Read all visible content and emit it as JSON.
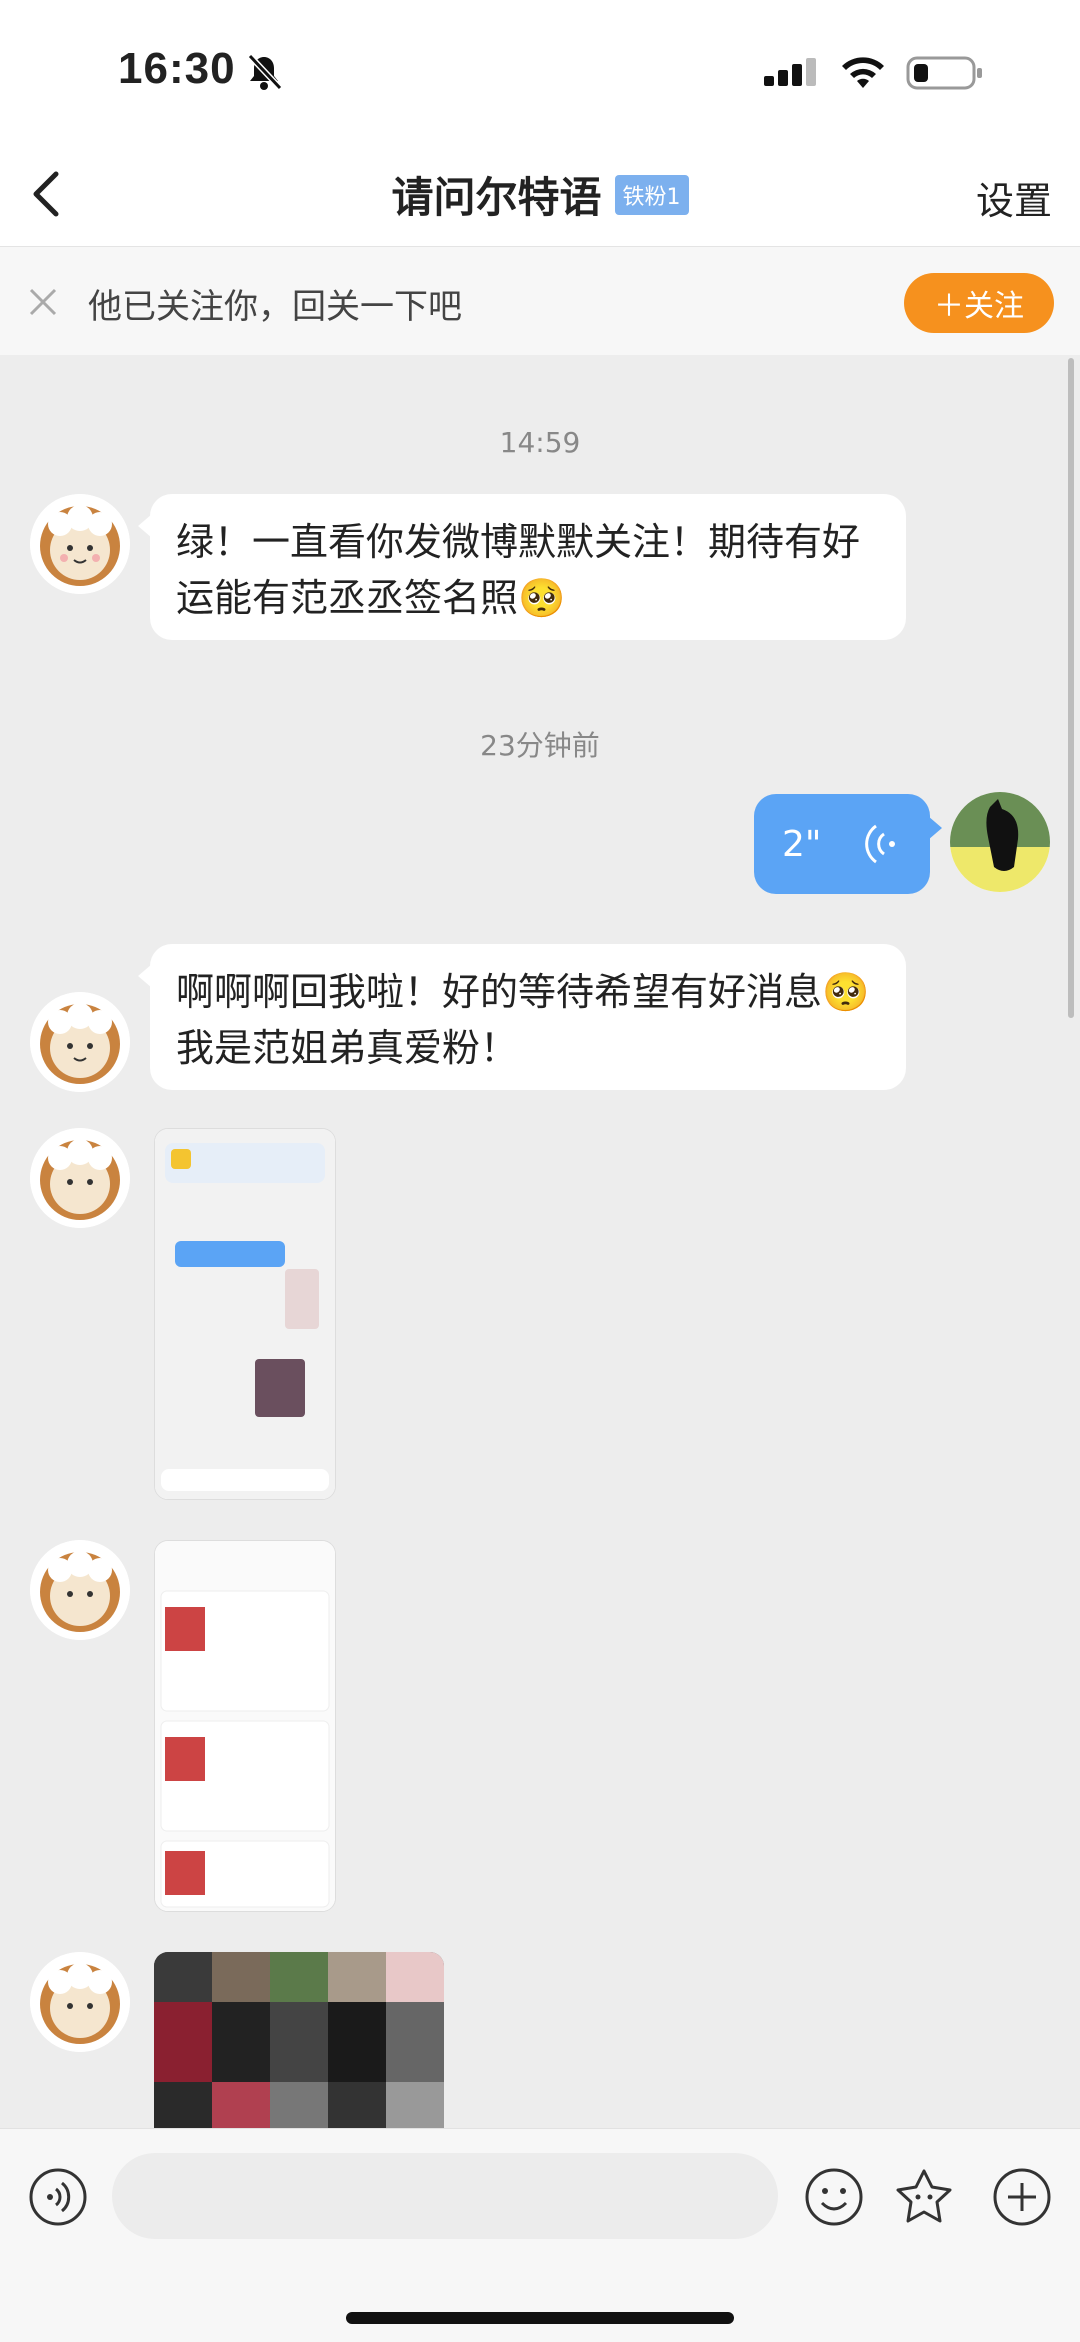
{
  "status": {
    "time": "16:30"
  },
  "nav": {
    "title": "请问尔特语",
    "badge": "铁粉1",
    "settings": "设置"
  },
  "follow_bar": {
    "text": "他已关注你，回关一下吧",
    "button": "＋关注"
  },
  "messages": {
    "ts1": "14:59",
    "m1": "绿！一直看你发微博默默关注！期待有好运能有范丞丞签名照🥺",
    "ts2": "23分钟前",
    "voice": "2\"",
    "m2": "啊啊啊回我啦！好的等待希望有好消息🥺我是范姐弟真爱粉！"
  },
  "colors": {
    "accent_orange": "#f6911e",
    "bubble_blue": "#5ba4f5",
    "badge_blue": "#7cb0ee"
  },
  "icons": [
    "back-icon",
    "bell-slash-icon",
    "signal-icon",
    "wifi-icon",
    "battery-icon",
    "close-icon",
    "voice-input-icon",
    "emoji-icon",
    "sticker-icon",
    "plus-icon"
  ]
}
